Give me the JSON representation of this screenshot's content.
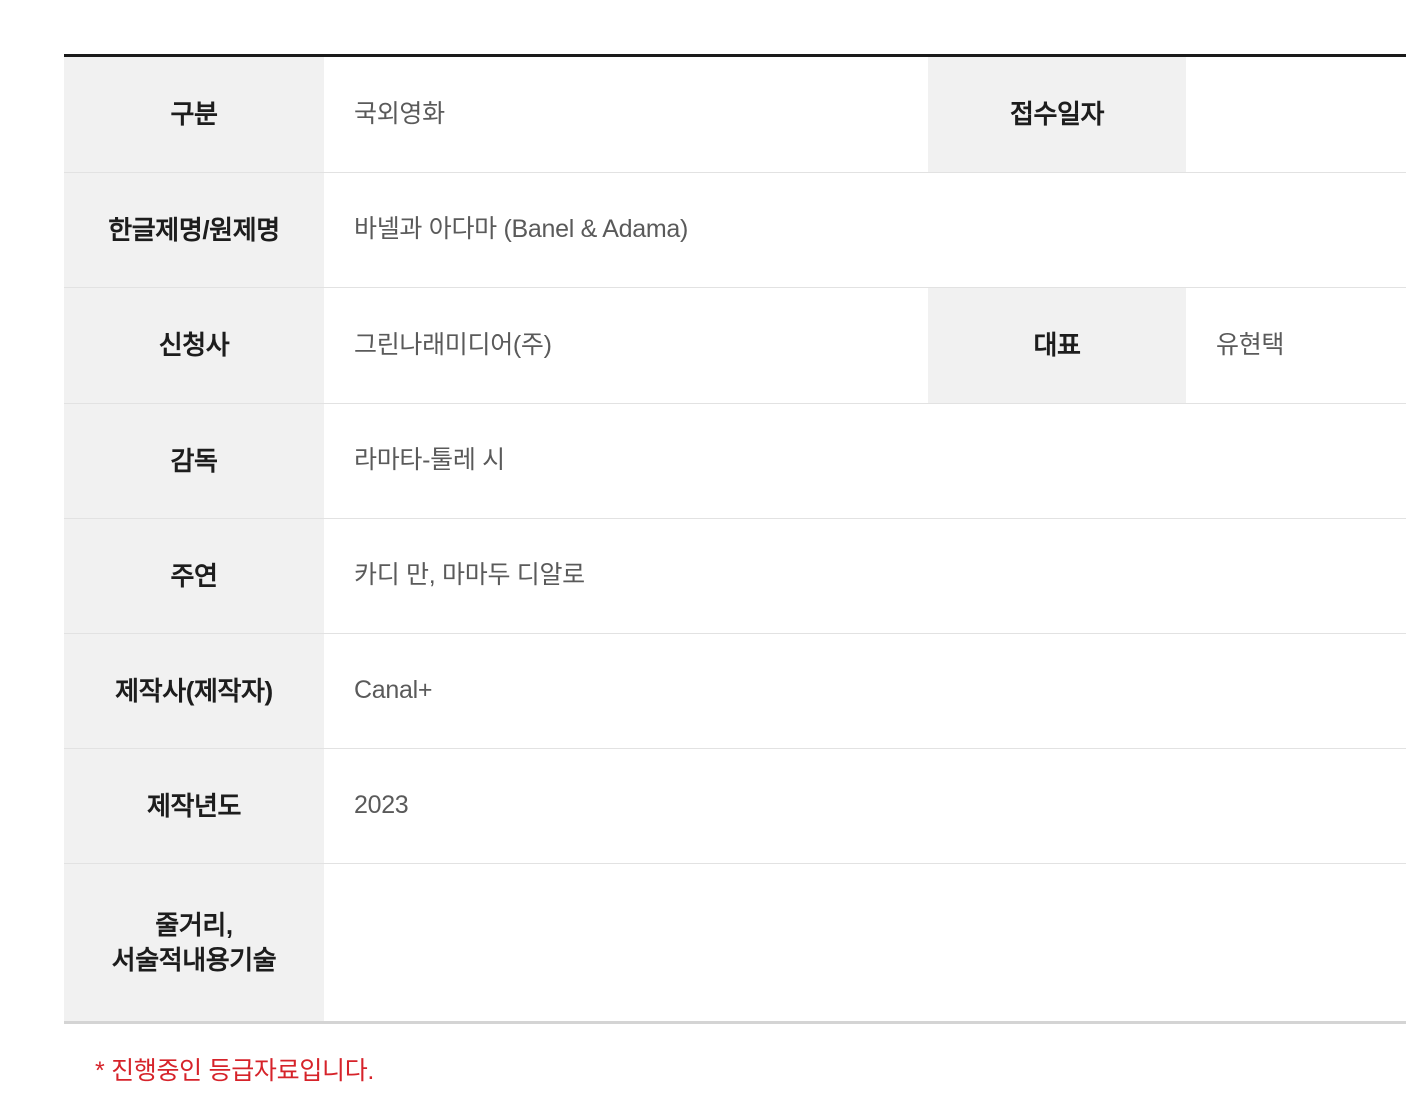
{
  "table": {
    "rows": [
      {
        "label": "구분",
        "value": "국외영화",
        "label2": "접수일자",
        "value2": ""
      },
      {
        "label": "한글제명/원제명",
        "value": "바넬과 아다마  (Banel & Adama)"
      },
      {
        "label": "신청사",
        "value": "그린나래미디어(주)",
        "label2": "대표",
        "value2": "유현택"
      },
      {
        "label": "감독",
        "value": "라마타-툴레 시"
      },
      {
        "label": "주연",
        "value": "카디 만, 마마두 디알로"
      },
      {
        "label": "제작사(제작자)",
        "value": "Canal+"
      },
      {
        "label": "제작년도",
        "value": "2023"
      },
      {
        "label_line1": "줄거리,",
        "label_line2": "서술적내용기술",
        "value": ""
      }
    ]
  },
  "footnote": {
    "text": "* 진행중인 등급자료입니다.",
    "color": "#d6232a"
  },
  "colors": {
    "label_background": "#f1f1f1",
    "label_text": "#1d1d1d",
    "value_text": "#5a5a5a",
    "table_top_border": "#1a1a1a",
    "row_divider": "#e2e2e2",
    "page_background": "#ffffff"
  }
}
